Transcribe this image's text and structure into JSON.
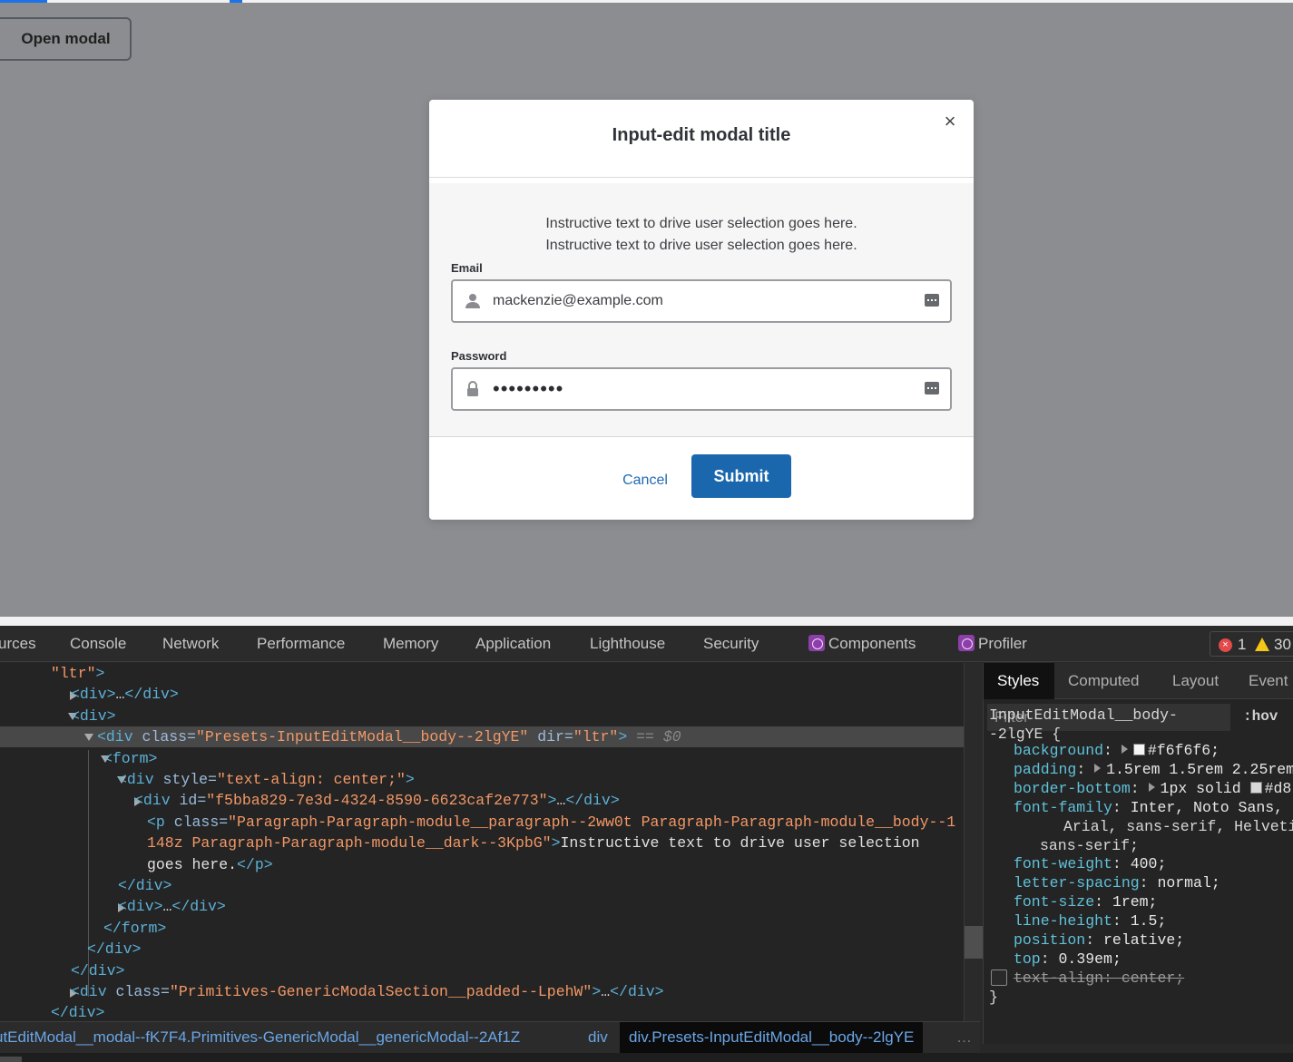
{
  "app": {
    "open_modal_label": "Open modal",
    "modal": {
      "title": "Input-edit modal title",
      "close_glyph": "×",
      "instructions": [
        "Instructive text to drive user selection goes here.",
        "Instructive text to drive user selection goes here."
      ],
      "email": {
        "label": "Email",
        "value": "mackenzie@example.com"
      },
      "password": {
        "label": "Password",
        "value": "•••••••••"
      },
      "cancel_label": "Cancel",
      "submit_label": "Submit",
      "colors": {
        "primary": "#1a67ae",
        "body_bg": "#f6f6f6",
        "backdrop": "#8c8d91"
      }
    }
  },
  "devtools": {
    "tabs": [
      "urces",
      "Console",
      "Network",
      "Performance",
      "Memory",
      "Application",
      "Lighthouse",
      "Security",
      "Components",
      "Profiler"
    ],
    "error_count": "1",
    "warning_count": "30",
    "elements_lines": [
      {
        "indent": 0,
        "parts": [
          [
            "attrv",
            "\"ltr\""
          ],
          [
            "tagc",
            ">"
          ]
        ]
      },
      {
        "indent": 1,
        "parts": [
          [
            "tagc",
            "<div>"
          ],
          [
            "txt",
            "…"
          ],
          [
            "tagc",
            "</div>"
          ]
        ]
      },
      {
        "indent": 1,
        "parts": [
          [
            "tagc",
            "<div>"
          ]
        ]
      },
      {
        "indent": 2,
        "parts": [
          [
            "tagc",
            "<div "
          ],
          [
            "attrn",
            "class="
          ],
          [
            "attrv",
            "\"Presets-InputEditModal__body--2lgYE\""
          ],
          [
            "attrn",
            " dir="
          ],
          [
            "attrv",
            "\"ltr\""
          ],
          [
            "tagc",
            ">"
          ],
          [
            "dim",
            " == $0"
          ]
        ]
      },
      {
        "indent": 3,
        "parts": [
          [
            "tagc",
            "<form>"
          ]
        ]
      },
      {
        "indent": 4,
        "parts": [
          [
            "tagc",
            "<div "
          ],
          [
            "attrn",
            "style="
          ],
          [
            "attrv",
            "\"text-align: center;\""
          ],
          [
            "tagc",
            ">"
          ]
        ]
      },
      {
        "indent": 5,
        "parts": [
          [
            "tagc",
            "<div "
          ],
          [
            "attrn",
            "id="
          ],
          [
            "attrv",
            "\"f5bba829-7e3d-4324-8590-6623caf2e773\""
          ],
          [
            "tagc",
            ">"
          ],
          [
            "txt",
            "…"
          ],
          [
            "tagc",
            "</div>"
          ]
        ]
      },
      {
        "indent": 5,
        "parts": [
          [
            "tagc",
            "<p "
          ],
          [
            "attrn",
            "class="
          ],
          [
            "attrv",
            "\"Paragraph-Paragraph-module__paragraph--2ww0t Paragraph-Paragraph-module__body--1"
          ]
        ]
      },
      {
        "indent": 5,
        "parts": [
          [
            "attrv",
            "148z Paragraph-Paragraph-module__dark--3KpbG\""
          ],
          [
            "tagc",
            ">"
          ],
          [
            "txt",
            "Instructive text to drive user selection"
          ]
        ]
      },
      {
        "indent": 5,
        "parts": [
          [
            "txt",
            "goes here."
          ],
          [
            "tagc",
            "</p>"
          ]
        ]
      },
      {
        "indent": 4,
        "parts": [
          [
            "tagc",
            "</div>"
          ]
        ]
      },
      {
        "indent": 4,
        "parts": [
          [
            "tagc",
            "<div>"
          ],
          [
            "txt",
            "…"
          ],
          [
            "tagc",
            "</div>"
          ]
        ]
      },
      {
        "indent": 3,
        "parts": [
          [
            "tagc",
            "</form>"
          ]
        ]
      },
      {
        "indent": 2,
        "parts": [
          [
            "tagc",
            "</div>"
          ]
        ]
      },
      {
        "indent": 1,
        "parts": [
          [
            "tagc",
            "</div>"
          ]
        ]
      },
      {
        "indent": 1,
        "parts": [
          [
            "tagc",
            "<div "
          ],
          [
            "attrn",
            "class="
          ],
          [
            "attrv",
            "\"Primitives-GenericModalSection__padded--LpehW\""
          ],
          [
            "tagc",
            ">"
          ],
          [
            "txt",
            "…"
          ],
          [
            "tagc",
            "</div>"
          ]
        ]
      },
      {
        "indent": 0,
        "parts": [
          [
            "tagc",
            "</div>"
          ]
        ]
      }
    ],
    "styles_tabs": [
      "Styles",
      "Computed",
      "Layout",
      "Event"
    ],
    "filter_placeholder": "Filter",
    "hov_label": ":hov",
    "selector": [
      "InputEditModal__body-",
      "-2lgYE {"
    ],
    "rules": [
      {
        "prop": "background",
        "val": "#f6f6f6;",
        "swatch": "#f6f6f6",
        "expand": true
      },
      {
        "prop": "padding",
        "val": "1.5rem 1.5rem 2.25rem",
        "expand": true
      },
      {
        "prop": "border-bottom",
        "val": "1px solid ",
        "val2": "#d8",
        "swatch": "#d8d8d8",
        "expand": true
      },
      {
        "prop": "font-family",
        "val": "Inter, Noto Sans,"
      },
      {
        "cont": "Arial, sans-serif, Helveti"
      },
      {
        "cont2": "sans-serif;"
      },
      {
        "prop": "font-weight",
        "val": "400;"
      },
      {
        "prop": "letter-spacing",
        "val": "normal;"
      },
      {
        "prop": "font-size",
        "val": "1rem;"
      },
      {
        "prop": "line-height",
        "val": "1.5;"
      },
      {
        "prop": "position",
        "val": "relative;"
      },
      {
        "prop": "top",
        "val": "0.39em;"
      },
      {
        "prop": "text-align",
        "val": "center;",
        "disabled": true
      }
    ],
    "closing_brace": "}",
    "breadcrumbs": [
      "utEditModal__modal--fK7F4.Primitives-GenericModal__genericModal--2Af1Z",
      "div",
      "div.Presets-InputEditModal__body--2lgYE"
    ],
    "more_glyph": "…"
  }
}
